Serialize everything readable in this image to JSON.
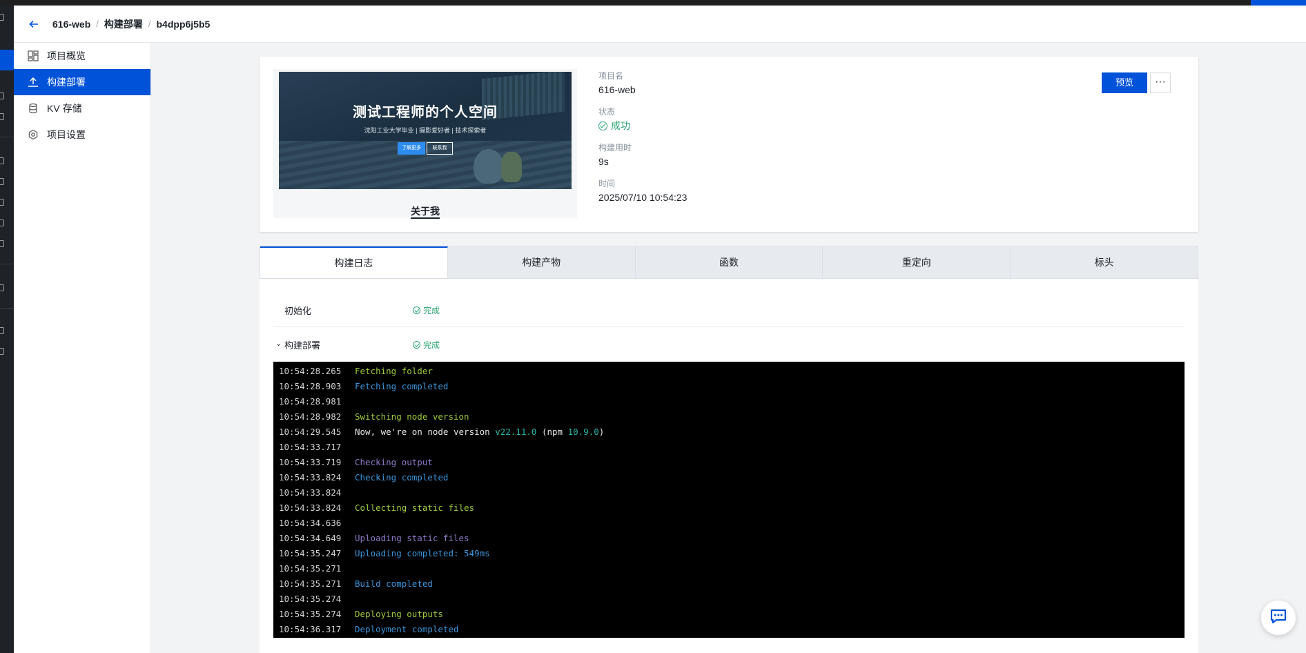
{
  "header": {
    "breadcrumb": [
      "616-web",
      "构建部署",
      "b4dpp6j5b5"
    ]
  },
  "sidebar": {
    "items": [
      {
        "label": "项目概览",
        "icon": "dashboard-icon",
        "active": false
      },
      {
        "label": "构建部署",
        "icon": "upload-icon",
        "active": true
      },
      {
        "label": "KV 存储",
        "icon": "database-icon",
        "active": false
      },
      {
        "label": "项目设置",
        "icon": "settings-icon",
        "active": false
      }
    ]
  },
  "deployment": {
    "thumbnail": {
      "title": "测试工程师的个人空间",
      "subtitle": "沈阳工业大学毕业 | 摄影爱好者 | 技术探索者",
      "button1": "了解更多",
      "button2": "联系我",
      "caption": "关于我"
    },
    "fields": [
      {
        "label": "项目名",
        "value": "616-web"
      },
      {
        "label": "状态",
        "value": "成功",
        "status": "success"
      },
      {
        "label": "构建用时",
        "value": "9s"
      },
      {
        "label": "时间",
        "value": "2025/07/10 10:54:23"
      }
    ],
    "preview_label": "预览",
    "more_label": "···"
  },
  "tabs": [
    {
      "label": "构建日志",
      "active": true
    },
    {
      "label": "构建产物",
      "active": false
    },
    {
      "label": "函数",
      "active": false
    },
    {
      "label": "重定向",
      "active": false
    },
    {
      "label": "标头",
      "active": false
    }
  ],
  "stages": [
    {
      "name": "初始化",
      "status": "完成"
    },
    {
      "name": "构建部署",
      "status": "完成"
    }
  ],
  "log_lines": [
    {
      "ts": "10:54:28.265",
      "parts": [
        {
          "text": "Fetching folder",
          "color": "green"
        }
      ]
    },
    {
      "ts": "10:54:28.903",
      "parts": [
        {
          "text": "Fetching completed",
          "color": "blue"
        }
      ]
    },
    {
      "ts": "10:54:28.981",
      "parts": []
    },
    {
      "ts": "10:54:28.982",
      "parts": [
        {
          "text": "Switching node version",
          "color": "green"
        }
      ]
    },
    {
      "ts": "10:54:29.545",
      "parts": [
        {
          "text": "Now, we're on node version ",
          "color": "white"
        },
        {
          "text": "v22.11.0",
          "color": "cyan"
        },
        {
          "text": " (npm ",
          "color": "white"
        },
        {
          "text": "10.9.0",
          "color": "cyan"
        },
        {
          "text": ")",
          "color": "white"
        }
      ]
    },
    {
      "ts": "10:54:33.717",
      "parts": []
    },
    {
      "ts": "10:54:33.719",
      "parts": [
        {
          "text": "Checking output",
          "color": "purple"
        }
      ]
    },
    {
      "ts": "10:54:33.824",
      "parts": [
        {
          "text": "Checking completed",
          "color": "blue"
        }
      ]
    },
    {
      "ts": "10:54:33.824",
      "parts": []
    },
    {
      "ts": "10:54:33.824",
      "parts": [
        {
          "text": "Collecting static files",
          "color": "green"
        }
      ]
    },
    {
      "ts": "10:54:34.636",
      "parts": []
    },
    {
      "ts": "10:54:34.649",
      "parts": [
        {
          "text": "Uploading static files",
          "color": "purple"
        }
      ]
    },
    {
      "ts": "10:54:35.247",
      "parts": [
        {
          "text": "Uploading completed: 549ms",
          "color": "blue"
        }
      ]
    },
    {
      "ts": "10:54:35.271",
      "parts": []
    },
    {
      "ts": "10:54:35.271",
      "parts": [
        {
          "text": "Build completed",
          "color": "blue"
        }
      ]
    },
    {
      "ts": "10:54:35.274",
      "parts": []
    },
    {
      "ts": "10:54:35.274",
      "parts": [
        {
          "text": "Deploying outputs",
          "color": "green"
        }
      ]
    },
    {
      "ts": "10:54:36.317",
      "parts": [
        {
          "text": "Deployment completed",
          "color": "blue"
        }
      ]
    }
  ],
  "colors": {
    "accent": "#0052d9",
    "success": "#2ba471",
    "log_green": "#9ecb3d",
    "log_blue": "#3a96dd",
    "log_purple": "#8f79c9",
    "log_cyan": "#27b8a8"
  }
}
